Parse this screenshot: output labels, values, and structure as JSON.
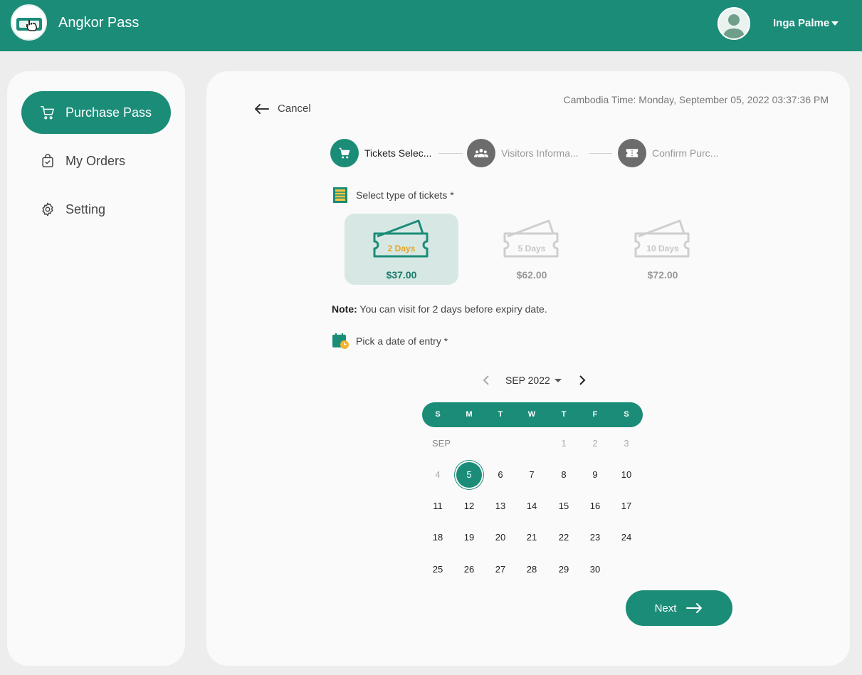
{
  "header": {
    "app_title": "Angkor Pass",
    "user_name": "Inga Palme",
    "brand_color": "#1b8c78"
  },
  "sidebar": {
    "items": [
      {
        "label": "Purchase Pass",
        "icon": "cart-icon",
        "active": true
      },
      {
        "label": "My Orders",
        "icon": "shopping-bag-icon",
        "active": false
      },
      {
        "label": "Setting",
        "icon": "gear-icon",
        "active": false
      }
    ]
  },
  "main": {
    "cancel_label": "Cancel",
    "cambodia_time": "Cambodia Time: Monday, September 05, 2022 03:37:36 PM",
    "steps": [
      {
        "label": "Tickets Selec...",
        "icon": "cart-icon",
        "active": true
      },
      {
        "label": "Visitors Informa...",
        "icon": "group-icon",
        "active": false
      },
      {
        "label": "Confirm Purc...",
        "icon": "ticket-icon",
        "active": false
      }
    ],
    "select_tickets_label": "Select type of tickets *",
    "tickets": [
      {
        "days": "2 Days",
        "price": "$37.00",
        "selected": true
      },
      {
        "days": "5 Days",
        "price": "$62.00",
        "selected": false
      },
      {
        "days": "10 Days",
        "price": "$72.00",
        "selected": false
      }
    ],
    "note_bold": "Note:",
    "note_text": " You can visit for 2 days before expiry date.",
    "pick_date_label": "Pick a date of entry *",
    "calendar": {
      "month_label": "SEP 2022",
      "row_label": "SEP",
      "weekdays": [
        "S",
        "M",
        "T",
        "W",
        "T",
        "F",
        "S"
      ],
      "selected_day": "5",
      "muted_days": [
        "1",
        "2",
        "3",
        "4"
      ],
      "weeks": [
        [
          "",
          "",
          "",
          "",
          "1",
          "2",
          "3"
        ],
        [
          "4",
          "5",
          "6",
          "7",
          "8",
          "9",
          "10"
        ],
        [
          "11",
          "12",
          "13",
          "14",
          "15",
          "16",
          "17"
        ],
        [
          "18",
          "19",
          "20",
          "21",
          "22",
          "23",
          "24"
        ],
        [
          "25",
          "26",
          "27",
          "28",
          "29",
          "30",
          ""
        ]
      ]
    },
    "next_label": "Next"
  }
}
